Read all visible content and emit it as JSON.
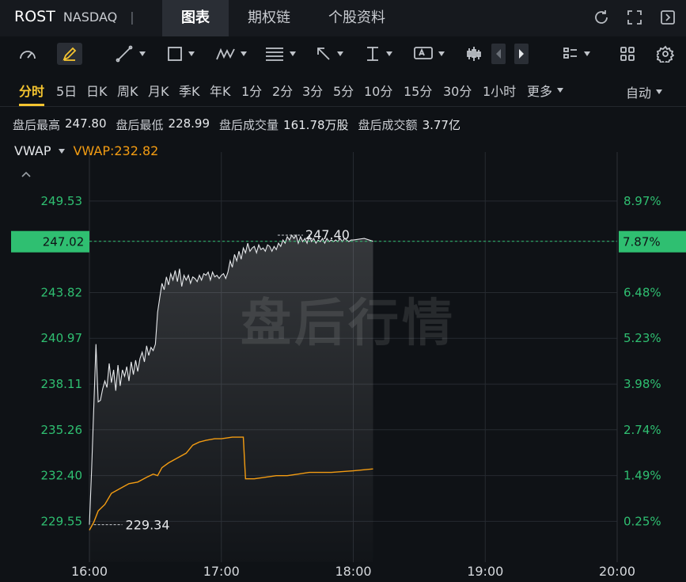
{
  "header": {
    "symbol": "ROST",
    "exchange": "NASDAQ",
    "separator": "|",
    "tabs": [
      {
        "label": "图表",
        "active": true
      },
      {
        "label": "期权链",
        "active": false
      },
      {
        "label": "个股资料",
        "active": false
      }
    ],
    "icons": [
      "refresh-icon",
      "fullscreen-icon",
      "collapse-panel-icon"
    ]
  },
  "toolbar": {
    "icons": [
      "gauge-icon",
      "draw-pen-icon",
      "line-tool-icon",
      "rectangle-tool-icon",
      "wave-tool-icon",
      "fib-tool-icon",
      "arrow-tool-icon",
      "vertical-measure-icon",
      "text-tool-icon",
      "candle-icon",
      "prev-icon",
      "next-icon",
      "layout-icon",
      "grid-icon",
      "settings-icon"
    ]
  },
  "periods": [
    "分时",
    "5日",
    "日K",
    "周K",
    "月K",
    "季K",
    "年K",
    "1分",
    "2分",
    "3分",
    "5分",
    "10分",
    "15分",
    "30分",
    "1小时",
    "更多"
  ],
  "active_period": "分时",
  "auto_label": "自动",
  "stats": [
    {
      "label": "盘后最高",
      "value": "247.80"
    },
    {
      "label": "盘后最低",
      "value": "228.99"
    },
    {
      "label": "盘后成交量",
      "value": "161.78万股"
    },
    {
      "label": "盘后成交额",
      "value": "3.77亿"
    }
  ],
  "indicator": {
    "name": "VWAP",
    "value_label": "VWAP:232.82"
  },
  "watermark": "盘后行情",
  "colors": {
    "price_line": "#e6e8eb",
    "vwap_line": "#f39c12",
    "axis_green": "#2fbf71",
    "current_badge": "#2fbf71"
  },
  "chart_data": {
    "type": "line",
    "x_ticks": [
      "16:00",
      "17:00",
      "18:00",
      "19:00",
      "20:00"
    ],
    "xlim": [
      "16:00",
      "20:00"
    ],
    "y_ticks": [
      "249.53",
      "247.02",
      "243.82",
      "240.97",
      "238.11",
      "235.26",
      "232.40",
      "229.55"
    ],
    "pct_ticks": [
      "8.97%",
      "7.87%",
      "6.48%",
      "5.23%",
      "3.98%",
      "2.74%",
      "1.49%",
      "0.25%"
    ],
    "ylim": [
      227.0,
      251.6
    ],
    "current_price": 247.02,
    "current_pct": "7.87%",
    "high_annotation": {
      "time": "17:40",
      "value": 247.4,
      "label": "247.40"
    },
    "low_annotation": {
      "time": "16:02",
      "value": 229.34,
      "label": "229.34"
    },
    "price_series": [
      [
        "16:00",
        229.34
      ],
      [
        "16:01",
        232.8
      ],
      [
        "16:03",
        240.6
      ],
      [
        "16:04",
        237.0
      ],
      [
        "16:05",
        237.1
      ],
      [
        "16:06",
        237.8
      ],
      [
        "16:07",
        238.3
      ],
      [
        "16:08",
        237.9
      ],
      [
        "16:09",
        239.4
      ],
      [
        "16:10",
        238.2
      ],
      [
        "16:11",
        239.0
      ],
      [
        "16:12",
        237.7
      ],
      [
        "16:13",
        239.3
      ],
      [
        "16:14",
        238.0
      ],
      [
        "16:15",
        239.0
      ],
      [
        "16:16",
        238.6
      ],
      [
        "16:17",
        239.2
      ],
      [
        "16:18",
        238.3
      ],
      [
        "16:19",
        239.5
      ],
      [
        "16:20",
        238.7
      ],
      [
        "16:21",
        239.6
      ],
      [
        "16:22",
        238.9
      ],
      [
        "16:23",
        239.7
      ],
      [
        "16:24",
        240.1
      ],
      [
        "16:25",
        239.5
      ],
      [
        "16:26",
        240.5
      ],
      [
        "16:27",
        239.9
      ],
      [
        "16:28",
        240.4
      ],
      [
        "16:29",
        240.2
      ],
      [
        "16:30",
        240.6
      ],
      [
        "16:31",
        242.6
      ],
      [
        "16:32",
        243.5
      ],
      [
        "16:33",
        244.4
      ],
      [
        "16:34",
        244.0
      ],
      [
        "16:35",
        244.8
      ],
      [
        "16:36",
        244.3
      ],
      [
        "16:37",
        245.0
      ],
      [
        "16:38",
        244.6
      ],
      [
        "16:39",
        245.2
      ],
      [
        "16:40",
        244.5
      ],
      [
        "16:41",
        245.3
      ],
      [
        "16:42",
        244.2
      ],
      [
        "16:43",
        244.9
      ],
      [
        "16:44",
        244.6
      ],
      [
        "16:45",
        244.9
      ],
      [
        "16:46",
        244.4
      ],
      [
        "16:47",
        244.8
      ],
      [
        "16:48",
        244.7
      ],
      [
        "16:49",
        244.5
      ],
      [
        "16:50",
        244.9
      ],
      [
        "16:51",
        244.6
      ],
      [
        "16:52",
        245.0
      ],
      [
        "16:53",
        244.9
      ],
      [
        "16:54",
        245.1
      ],
      [
        "16:55",
        244.6
      ],
      [
        "16:56",
        245.1
      ],
      [
        "16:57",
        244.8
      ],
      [
        "16:58",
        244.9
      ],
      [
        "16:59",
        244.7
      ],
      [
        "17:00",
        244.9
      ],
      [
        "17:01",
        245.0
      ],
      [
        "17:02",
        244.7
      ],
      [
        "17:03",
        245.1
      ],
      [
        "17:04",
        245.8
      ],
      [
        "17:05",
        245.4
      ],
      [
        "17:06",
        246.2
      ],
      [
        "17:07",
        245.8
      ],
      [
        "17:08",
        246.4
      ],
      [
        "17:09",
        245.9
      ],
      [
        "17:10",
        246.6
      ],
      [
        "17:11",
        246.3
      ],
      [
        "17:12",
        246.9
      ],
      [
        "17:13",
        246.4
      ],
      [
        "17:14",
        246.6
      ],
      [
        "17:15",
        246.7
      ],
      [
        "17:16",
        246.3
      ],
      [
        "17:17",
        246.8
      ],
      [
        "17:18",
        246.5
      ],
      [
        "17:19",
        246.6
      ],
      [
        "17:20",
        246.4
      ],
      [
        "17:21",
        246.8
      ],
      [
        "17:22",
        246.7
      ],
      [
        "17:23",
        246.4
      ],
      [
        "17:24",
        246.7
      ],
      [
        "17:25",
        246.5
      ],
      [
        "17:26",
        246.9
      ],
      [
        "17:27",
        246.7
      ],
      [
        "17:28",
        247.1
      ],
      [
        "17:29",
        246.9
      ],
      [
        "17:30",
        247.3
      ],
      [
        "17:31",
        247.1
      ],
      [
        "17:32",
        247.4
      ],
      [
        "17:33",
        247.2
      ],
      [
        "17:34",
        247.4
      ],
      [
        "17:35",
        246.9
      ],
      [
        "17:36",
        247.3
      ],
      [
        "17:37",
        247.0
      ],
      [
        "17:38",
        247.2
      ],
      [
        "17:39",
        246.9
      ],
      [
        "17:40",
        247.4
      ],
      [
        "17:41",
        247.0
      ],
      [
        "17:42",
        247.2
      ],
      [
        "17:43",
        246.9
      ],
      [
        "17:44",
        247.1
      ],
      [
        "17:45",
        247.0
      ],
      [
        "17:46",
        247.2
      ],
      [
        "17:47",
        246.9
      ],
      [
        "17:48",
        247.2
      ],
      [
        "17:49",
        247.0
      ],
      [
        "17:50",
        247.1
      ],
      [
        "17:51",
        247.0
      ],
      [
        "17:52",
        247.1
      ],
      [
        "17:53",
        247.0
      ],
      [
        "17:54",
        247.2
      ],
      [
        "17:55",
        247.0
      ],
      [
        "17:56",
        247.2
      ],
      [
        "17:57",
        247.1
      ],
      [
        "17:58",
        247.0
      ],
      [
        "17:59",
        247.1
      ],
      [
        "18:00",
        247.1
      ],
      [
        "18:05",
        247.2
      ],
      [
        "18:09",
        247.02
      ]
    ],
    "vwap_series": [
      [
        "16:00",
        229.0
      ],
      [
        "16:02",
        229.5
      ],
      [
        "16:04",
        230.2
      ],
      [
        "16:07",
        230.6
      ],
      [
        "16:10",
        231.3
      ],
      [
        "16:14",
        231.6
      ],
      [
        "16:18",
        231.9
      ],
      [
        "16:22",
        232.0
      ],
      [
        "16:26",
        232.3
      ],
      [
        "16:29",
        232.5
      ],
      [
        "16:31",
        232.4
      ],
      [
        "16:33",
        232.9
      ],
      [
        "16:36",
        233.2
      ],
      [
        "16:40",
        233.5
      ],
      [
        "16:44",
        233.8
      ],
      [
        "16:47",
        234.3
      ],
      [
        "16:50",
        234.5
      ],
      [
        "16:53",
        234.6
      ],
      [
        "16:57",
        234.7
      ],
      [
        "17:00",
        234.7
      ],
      [
        "17:05",
        234.8
      ],
      [
        "17:10",
        234.8
      ],
      [
        "17:11",
        232.2
      ],
      [
        "17:15",
        232.2
      ],
      [
        "17:20",
        232.3
      ],
      [
        "17:25",
        232.4
      ],
      [
        "17:30",
        232.4
      ],
      [
        "17:35",
        232.5
      ],
      [
        "17:40",
        232.6
      ],
      [
        "17:50",
        232.6
      ],
      [
        "18:00",
        232.7
      ],
      [
        "18:09",
        232.82
      ]
    ]
  }
}
